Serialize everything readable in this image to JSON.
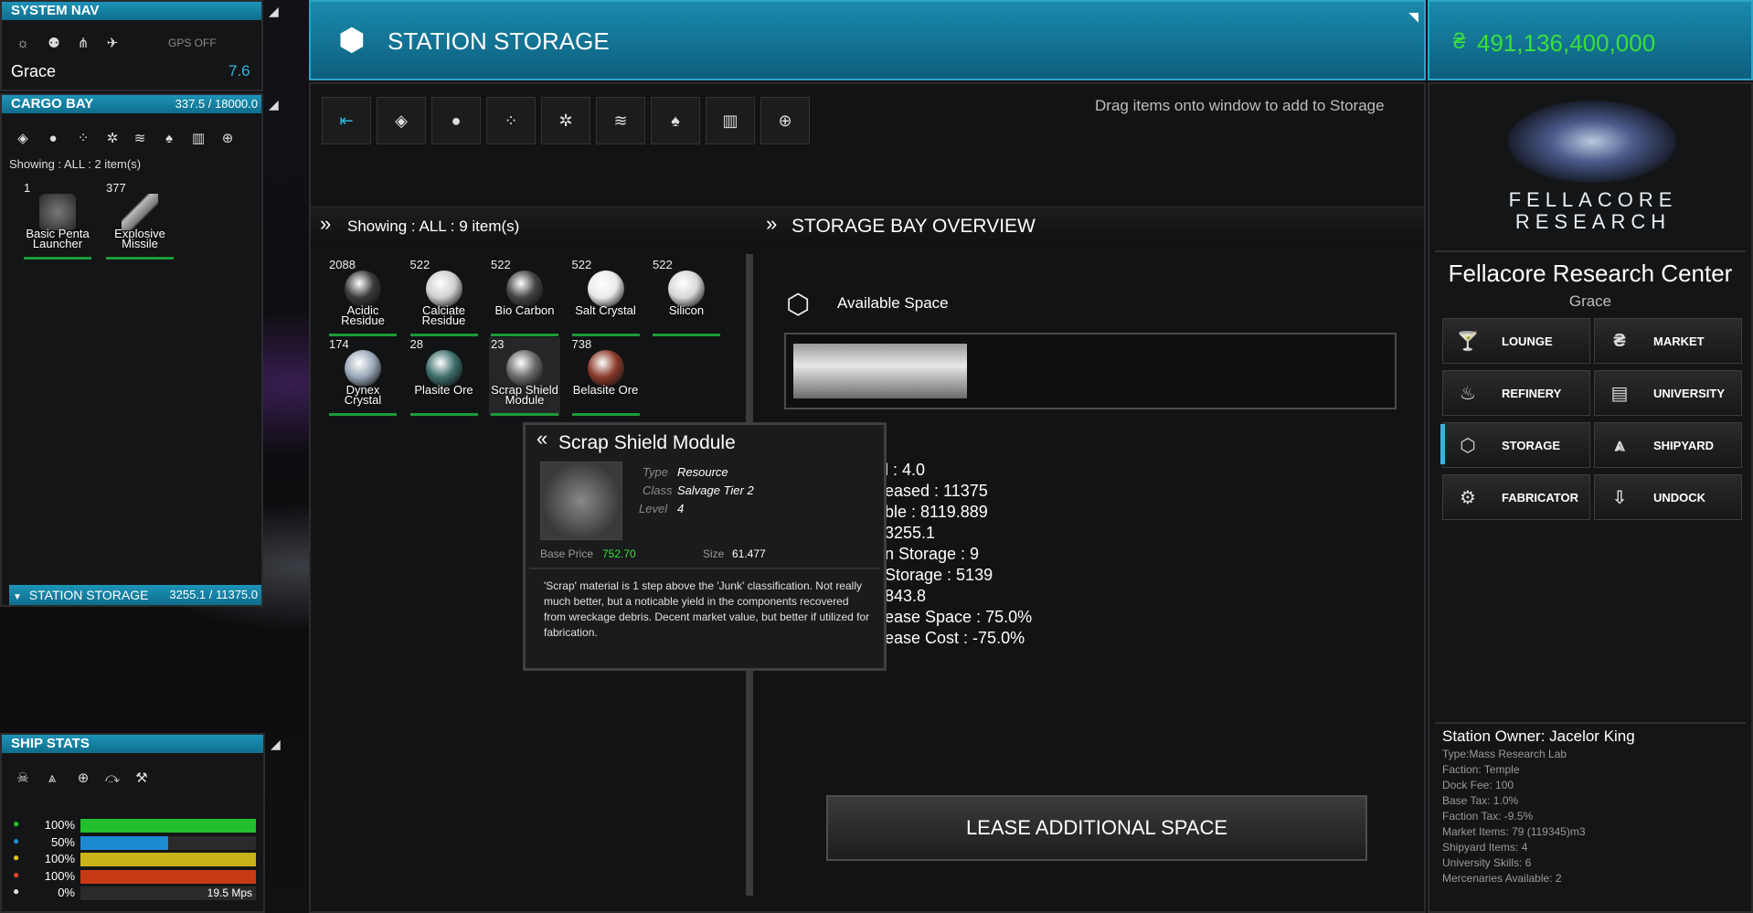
{
  "system_nav": {
    "title": "SYSTEM NAV",
    "gps": "GPS OFF",
    "system_name": "Grace",
    "security": "7.6",
    "icons": [
      "sun-icon",
      "network-icon",
      "cluster-icon",
      "ship-icon"
    ]
  },
  "cargo_bay": {
    "title": "CARGO BAY",
    "capacity": "337.5 / 18000.0",
    "showing": "Showing : ALL : 2 item(s)",
    "filters": [
      "diamond-icon",
      "ore-icon",
      "dots-icon",
      "flare-icon",
      "stack-icon",
      "drop-icon",
      "bars-icon",
      "plus-icon"
    ],
    "items": [
      {
        "count": "1",
        "label": "Basic Penta Launcher",
        "color": "#5a5a5a"
      },
      {
        "count": "377",
        "label": "Explosive Missile",
        "color": "#8a8a8a"
      }
    ]
  },
  "station_storage_tab": {
    "label": "STATION STORAGE",
    "capacity": "3255.1 / 11375.0"
  },
  "ship_stats": {
    "title": "SHIP STATS",
    "icons": [
      "skull-icon",
      "ship-icon",
      "plus-icon",
      "wing-icon",
      "tools-icon"
    ],
    "bars": [
      {
        "pct": "100%",
        "fill": 1.0,
        "color": "#22c02f",
        "icon": "shield-icon",
        "icon_color": "#22c02f"
      },
      {
        "pct": "50%",
        "fill": 0.5,
        "color": "#1e8ad0",
        "icon": "hull-icon",
        "icon_color": "#1e8ad0"
      },
      {
        "pct": "100%",
        "fill": 1.0,
        "color": "#c8b41a",
        "icon": "energy-icon",
        "icon_color": "#e0c020"
      },
      {
        "pct": "100%",
        "fill": 1.0,
        "color": "#c83a16",
        "icon": "heat-icon",
        "icon_color": "#e04020"
      },
      {
        "pct": "0%",
        "fill": 0.0,
        "color": "#777",
        "icon": "speed-icon",
        "icon_color": "#ddd",
        "extra": "19.5 Mps"
      }
    ]
  },
  "storage_window": {
    "title": "STATION STORAGE",
    "hint": "Drag items onto window to add to Storage",
    "toolbar": [
      "collapse-icon",
      "diamond-icon",
      "ore-icon",
      "dots-icon",
      "flare-icon",
      "stack-icon",
      "drop-icon",
      "bars-icon",
      "plus-icon"
    ],
    "showing": "Showing : ALL : 9 item(s)",
    "items": [
      {
        "count": "2088",
        "label": "Acidic Residue",
        "color": "#3a3a3a"
      },
      {
        "count": "522",
        "label": "Calciate Residue",
        "color": "#cfcfcf"
      },
      {
        "count": "522",
        "label": "Bio Carbon",
        "color": "#444"
      },
      {
        "count": "522",
        "label": "Salt Crystal",
        "color": "#eaeaea"
      },
      {
        "count": "522",
        "label": "Silicon",
        "color": "#d8d8d8"
      },
      {
        "count": "174",
        "label": "Dynex Crystal",
        "color": "#9aa8b8"
      },
      {
        "count": "28",
        "label": "Plasite Ore",
        "color": "#3d6e6a"
      },
      {
        "count": "23",
        "label": "Scrap Shield Module",
        "color": "#6a6a6a"
      },
      {
        "count": "738",
        "label": "Belasite Ore",
        "color": "#8a3a2a"
      }
    ]
  },
  "overview": {
    "title": "STORAGE BAY OVERVIEW",
    "available_label": "Available Space",
    "available_fill": 0.29,
    "lines": [
      "l : 4.0",
      "eased : 11375",
      "ble : 8119.889",
      "3255.1",
      "n Storage : 9",
      "Storage : 5139",
      "843.8",
      "ease Space : 75.0%",
      "ease Cost : -75.0%"
    ],
    "lease_button": "LEASE ADDITIONAL SPACE"
  },
  "tooltip": {
    "title": "Scrap Shield Module",
    "type_label": "Type",
    "type": "Resource",
    "class_label": "Class",
    "class": "Salvage Tier 2",
    "level_label": "Level",
    "level": "4",
    "base_price_label": "Base Price",
    "base_price": "752.70",
    "size_label": "Size",
    "size": "61.477",
    "description": "'Scrap' material is 1 step above the 'Junk' classification. Not really much better, but a noticable yield in the components recovered from wreckage debris. Decent market value, but better if utilized for fabrication."
  },
  "credits": {
    "symbol": "₴",
    "amount": "491,136,400,000",
    "color": "#3adf3a"
  },
  "station": {
    "logo_line1": "FELLACORE",
    "logo_line2": "RESEARCH",
    "name": "Fellacore Research Center",
    "system": "Grace",
    "nav": [
      {
        "label": "LOUNGE",
        "icon": "cocktail-icon",
        "glyph": "🍸"
      },
      {
        "label": "MARKET",
        "icon": "credits-icon",
        "glyph": "₴"
      },
      {
        "label": "REFINERY",
        "icon": "refinery-icon",
        "glyph": "♨"
      },
      {
        "label": "UNIVERSITY",
        "icon": "book-icon",
        "glyph": "▤"
      },
      {
        "label": "STORAGE",
        "icon": "storage-icon",
        "glyph": "⬡"
      },
      {
        "label": "SHIPYARD",
        "icon": "shipyard-icon",
        "glyph": "⩓"
      },
      {
        "label": "FABRICATOR",
        "icon": "fabricator-icon",
        "glyph": "⚙"
      },
      {
        "label": "UNDOCK",
        "icon": "undock-icon",
        "glyph": "⇩"
      }
    ],
    "owner": "Station Owner: Jacelor King",
    "details": [
      "Type:Mass Research Lab",
      "Faction: Temple",
      "Dock Fee: 100",
      "Base Tax: 1.0%",
      "Faction Tax: -9.5%",
      "Market Items: 79 (119345)m3",
      "Shipyard Items: 4",
      "University Skills: 6",
      "Mercenaries Available: 2"
    ]
  }
}
